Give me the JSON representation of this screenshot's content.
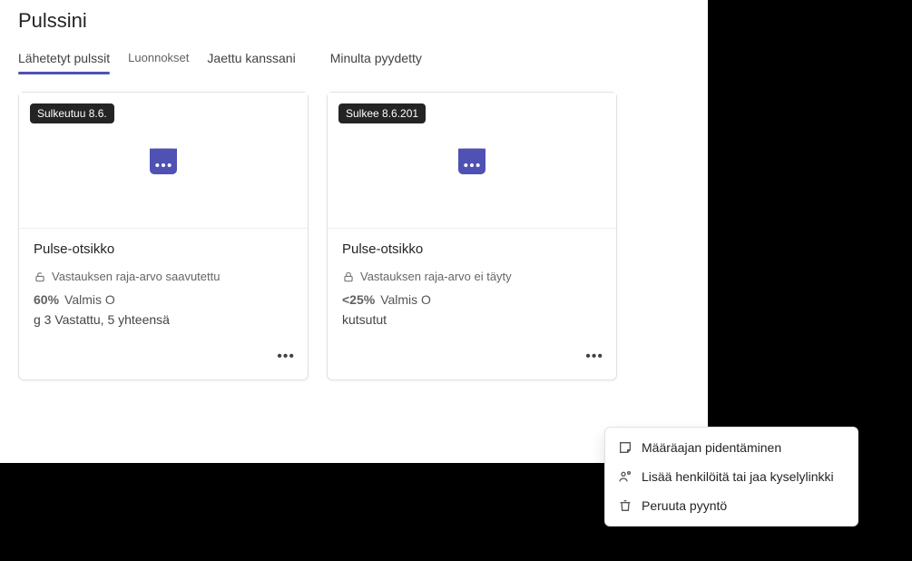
{
  "page": {
    "title": "Pulssini"
  },
  "tabs": [
    {
      "label": "Lähetetyt pulssit",
      "active": true
    },
    {
      "label": "Luonnokset"
    },
    {
      "label": "Jaettu kanssani"
    },
    {
      "label": "Minulta pyydetty"
    }
  ],
  "cards": [
    {
      "badge": "Sulkeutuu 8.6.",
      "title": "Pulse-otsikko",
      "status": "Vastauksen raja-arvo saavutettu",
      "pct": "60%",
      "pct_label": "Valmis O",
      "sub": "g 3 Vastattu, 5 yhteensä"
    },
    {
      "badge": "Sulkee 8.6.201",
      "title": "Pulse-otsikko",
      "status": "Vastauksen raja-arvo ei täyty",
      "pct": "<25%",
      "pct_label": "Valmis O",
      "sub": "kutsutut"
    }
  ],
  "context_menu": [
    {
      "label": "Määräajan pidentäminen"
    },
    {
      "label": "Lisää henkilöitä tai jaa kyselylinkki"
    },
    {
      "label": "Peruuta pyyntö"
    }
  ]
}
